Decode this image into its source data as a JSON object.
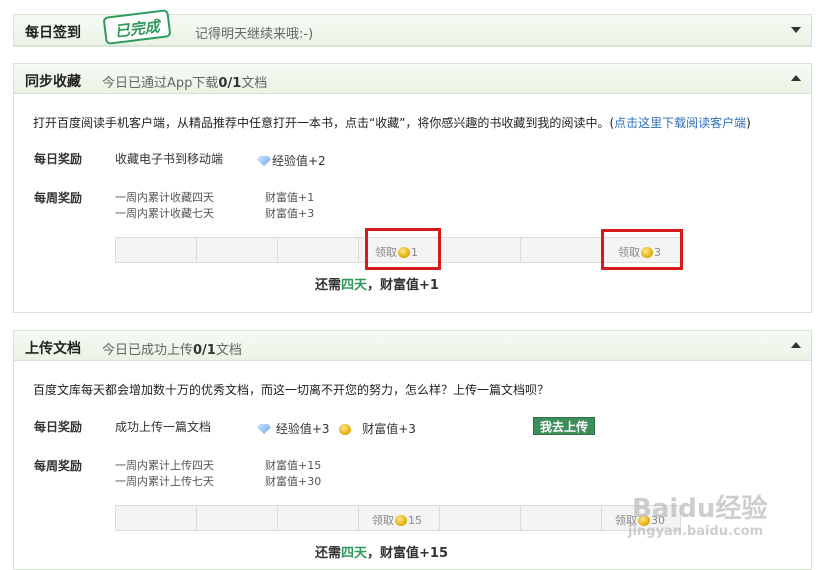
{
  "daily_checkin": {
    "title": "每日签到",
    "stamp": "已完成",
    "note": "记得明天继续来哦:-)"
  },
  "sync_collect": {
    "title": "同步收藏",
    "note_prefix": "今日已通过App下载",
    "note_count": "0/1",
    "note_suffix": "文档",
    "description": "打开百度阅读手机客户端，从精品推荐中任意打开一本书，点击“收藏”，将你感兴趣的书收藏到我的阅读中。(",
    "description_link": "点击这里下载阅读客户端",
    "description_end": ")",
    "daily_label": "每日奖励",
    "daily_task": "收藏电子书到移动端",
    "daily_reward": "经验值+2",
    "weekly_label": "每周奖励",
    "weekly_tasks": [
      "一周内累计收藏四天",
      "一周内累计收藏七天"
    ],
    "weekly_rewards": [
      "财富值+1",
      "财富值+3"
    ],
    "claims": [
      {
        "label": "领取",
        "amount": "1"
      },
      {
        "label": "领取",
        "amount": "3"
      }
    ],
    "summary_prefix": "还需",
    "summary_days": "四天",
    "summary_suffix": "，财富值+1"
  },
  "upload_doc": {
    "title": "上传文档",
    "note_prefix": "今日已成功上传",
    "note_count": "0/1",
    "note_suffix": "文档",
    "description": "百度文库每天都会增加数十万的优秀文档，而这一切离不开您的努力，怎么样？上传一篇文档呗？",
    "daily_label": "每日奖励",
    "daily_task": "成功上传一篇文档",
    "daily_reward_exp": "经验值+3",
    "daily_reward_wealth": "财富值+3",
    "go_button": "我去上传",
    "weekly_label": "每周奖励",
    "weekly_tasks": [
      "一周内累计上传四天",
      "一周内累计上传七天"
    ],
    "weekly_rewards": [
      "财富值+15",
      "财富值+30"
    ],
    "claims": [
      {
        "label": "领取",
        "amount": "15"
      },
      {
        "label": "领取",
        "amount": "30"
      }
    ],
    "summary_prefix": "还需",
    "summary_days": "四天",
    "summary_suffix": "，财富值+15"
  },
  "watermark": {
    "brand": "Baidu经验",
    "url": "jingyan.baidu.com"
  },
  "colors": {
    "accent_green": "#2f9a5a",
    "highlight_red": "#d71a1a",
    "link_blue": "#2b6fb6",
    "header_bg": "#e9f3e5"
  },
  "icons": [
    "chevron-down-icon",
    "chevron-up-icon",
    "gem-icon",
    "coin-icon"
  ]
}
